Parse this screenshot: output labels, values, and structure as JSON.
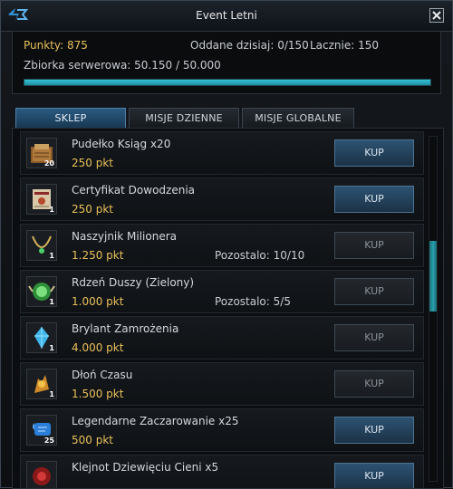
{
  "window": {
    "title": "Event Letni",
    "close_label": "✕"
  },
  "stats": {
    "points_label": "Punkty: 875",
    "today_label": "Oddane dzisiaj: 0/150",
    "total_label": "Lacznie: 150",
    "server_label": "Zbiorka serwerowa: 50.150 / 50.000",
    "server_progress_fraction": 1.0
  },
  "tabs": [
    {
      "label": "SKLEP",
      "active": true
    },
    {
      "label": "MISJE DZIENNE",
      "active": false
    },
    {
      "label": "MISJE GLOBALNE",
      "active": false
    }
  ],
  "items": [
    {
      "name": "Pudełko Ksiąg x20",
      "price": "250 pkt",
      "remaining": "",
      "qty": "20",
      "button": "KUP",
      "enabled": true,
      "icon": "book-box-icon"
    },
    {
      "name": "Certyfikat Dowodzenia",
      "price": "250 pkt",
      "remaining": "",
      "qty": "1",
      "button": "KUP",
      "enabled": true,
      "icon": "certificate-icon"
    },
    {
      "name": "Naszyjnik Milionera",
      "price": "1.250 pkt",
      "remaining": "Pozostalo: 10/10",
      "qty": "1",
      "button": "KUP",
      "enabled": false,
      "icon": "necklace-icon"
    },
    {
      "name": "Rdzeń Duszy (Zielony)",
      "price": "1.000 pkt",
      "remaining": "Pozostalo: 5/5",
      "qty": "1",
      "button": "KUP",
      "enabled": false,
      "icon": "soul-core-icon"
    },
    {
      "name": "Brylant Zamrożenia",
      "price": "4.000 pkt",
      "remaining": "",
      "qty": "1",
      "button": "KUP",
      "enabled": false,
      "icon": "frozen-diamond-icon"
    },
    {
      "name": "Dłoń Czasu",
      "price": "1.500 pkt",
      "remaining": "",
      "qty": "1",
      "button": "KUP",
      "enabled": false,
      "icon": "hand-of-time-icon"
    },
    {
      "name": "Legendarne Zaczarowanie x25",
      "price": "500 pkt",
      "remaining": "",
      "qty": "25",
      "button": "KUP",
      "enabled": true,
      "icon": "enchant-scroll-icon"
    },
    {
      "name": "Klejnot Dziewięciu Cieni x5",
      "price": "",
      "remaining": "",
      "qty": "",
      "button": "KUP",
      "enabled": true,
      "icon": "shadow-jewel-icon"
    }
  ]
}
